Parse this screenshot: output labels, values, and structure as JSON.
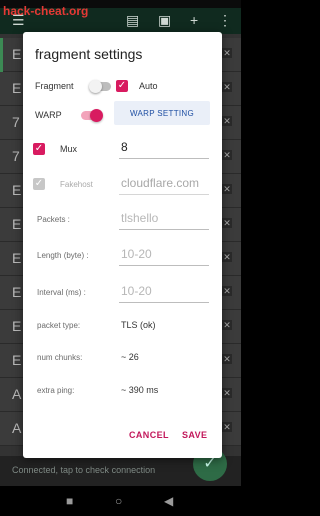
{
  "background": {
    "watermark": "hack-cheat.org",
    "list_letters": [
      "E",
      "E",
      "7",
      "7",
      "E",
      "E",
      "E",
      "E",
      "E",
      "E",
      "A",
      "A"
    ],
    "status": "Connected, tap to check connection"
  },
  "dialog": {
    "title": "fragment settings",
    "fragment_label": "Fragment",
    "fragment_on": false,
    "auto_label": "Auto",
    "auto_checked": true,
    "warp_label": "WARP",
    "warp_on": true,
    "warp_setting_button": "WARP SETTING",
    "mux_label": "Mux",
    "mux_checked": true,
    "mux_value": "8",
    "fakehost_label": "Fakehost",
    "fakehost_checked": true,
    "fakehost_value": "cloudflare.com",
    "packets_label": "Packets :",
    "packets_placeholder": "tlshello",
    "length_label": "Length (byte) :",
    "length_placeholder": "10-20",
    "interval_label": "Interval (ms) :",
    "interval_placeholder": "10-20",
    "packet_type_label": "packet type:",
    "packet_type_value": "TLS (ok)",
    "num_chunks_label": "num chunks:",
    "num_chunks_value": "~ 26",
    "extra_ping_label": "extra ping:",
    "extra_ping_value": "~ 390 ms",
    "cancel_button": "CANCEL",
    "save_button": "SAVE"
  },
  "colors": {
    "accent": "#d81b60",
    "button_text": "#1f4fa3"
  }
}
